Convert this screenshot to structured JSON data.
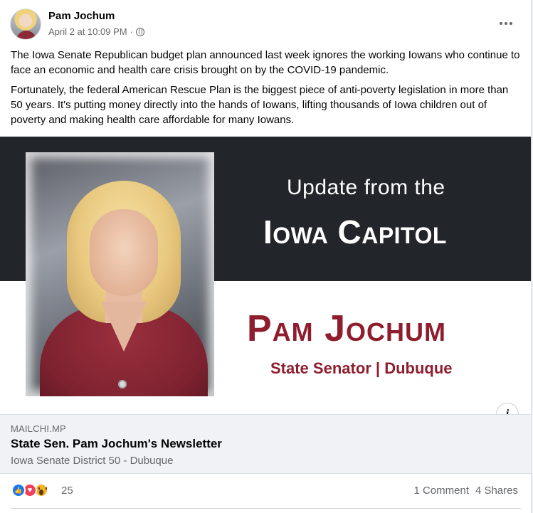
{
  "post": {
    "author": "Pam Jochum",
    "timestamp": "April 2 at 10:09 PM",
    "separator": "·",
    "privacy_icon": "globe-icon",
    "paragraphs": [
      "The Iowa Senate Republican budget plan announced last week ignores the working Iowans who continue to face an economic and health care crisis brought on by the COVID-19 pandemic.",
      "Fortunately, the federal American Rescue Plan is the biggest piece of anti-poverty legislation in more than 50 years. It's putting money directly into the hands of Iowans, lifting thousands of Iowa children out of poverty and making health care affordable for many Iowans."
    ]
  },
  "preview": {
    "update_line": "Update from the",
    "capitol_line": "Iowa Capitol",
    "senator_name": "Pam Jochum",
    "senator_role": "State Senator | Dubuque",
    "info_label": "i"
  },
  "link": {
    "domain": "MAILCHI.MP",
    "title": "State Sen. Pam Jochum's Newsletter",
    "description": "Iowa Senate District 50 - Dubuque"
  },
  "engagement": {
    "reaction_icons": [
      "like-icon",
      "love-icon",
      "wow-icon"
    ],
    "reaction_count": "25",
    "comments": "1 Comment",
    "shares": "4 Shares"
  },
  "colors": {
    "dark_band": "#22262b",
    "brand_maroon": "#8e1e2e",
    "facebook_blue": "#1877f2"
  }
}
